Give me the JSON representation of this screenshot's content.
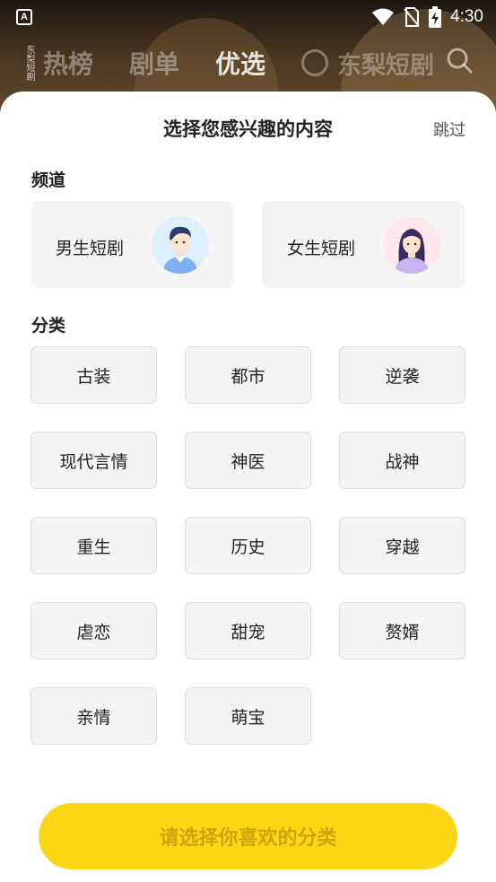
{
  "status_bar": {
    "app_badge": "A",
    "time": "4:30"
  },
  "top_nav": {
    "logo_text": "东梨短剧",
    "tabs": [
      {
        "label": "热榜"
      },
      {
        "label": "剧单"
      },
      {
        "label": "优选"
      }
    ],
    "brand_label": "东梨短剧",
    "active_tab": "优选"
  },
  "sheet": {
    "title": "选择您感兴趣的内容",
    "skip_label": "跳过",
    "channel_section_label": "频道",
    "channels": [
      {
        "label": "男生短剧",
        "avatar": "male-avatar-icon"
      },
      {
        "label": "女生短剧",
        "avatar": "female-avatar-icon"
      }
    ],
    "category_section_label": "分类",
    "categories": [
      {
        "label": "古装"
      },
      {
        "label": "都市"
      },
      {
        "label": "逆袭"
      },
      {
        "label": "现代言情"
      },
      {
        "label": "神医"
      },
      {
        "label": "战神"
      },
      {
        "label": "重生"
      },
      {
        "label": "历史"
      },
      {
        "label": "穿越"
      },
      {
        "label": "虐恋"
      },
      {
        "label": "甜宠"
      },
      {
        "label": "赘婿"
      },
      {
        "label": "亲情"
      },
      {
        "label": "萌宝"
      }
    ],
    "cta_label": "请选择你喜欢的分类"
  },
  "colors": {
    "accent": "#fcd513",
    "cta_text": "#c9a60a",
    "card_bg": "#f5f5f5"
  }
}
